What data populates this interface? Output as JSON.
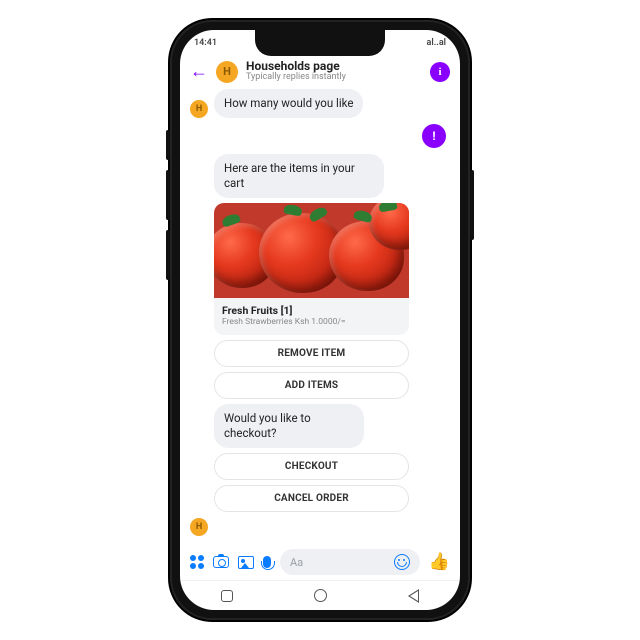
{
  "status": {
    "time": "14:41",
    "right": "al..al"
  },
  "header": {
    "avatar_letter": "H",
    "title": "Households page",
    "subtitle": "Typically replies instantly",
    "info_glyph": "i"
  },
  "messages": {
    "m1": {
      "avatar": "H",
      "text": "How many would you like"
    },
    "m2": {
      "glyph": "!"
    },
    "m3": {
      "text": "Here are the items in your cart"
    },
    "card": {
      "title": "Fresh Fruits [1]",
      "subtitle": "Fresh Strawberries Ksh 1.0000/="
    },
    "actions": {
      "remove": "REMOVE ITEM",
      "add": "ADD ITEMS"
    },
    "m4": {
      "text": "Would you like to checkout?"
    },
    "actions2": {
      "checkout": "CHECKOUT",
      "cancel": "CANCEL ORDER"
    },
    "m5_avatar": "H"
  },
  "composer": {
    "placeholder": "Aa"
  }
}
